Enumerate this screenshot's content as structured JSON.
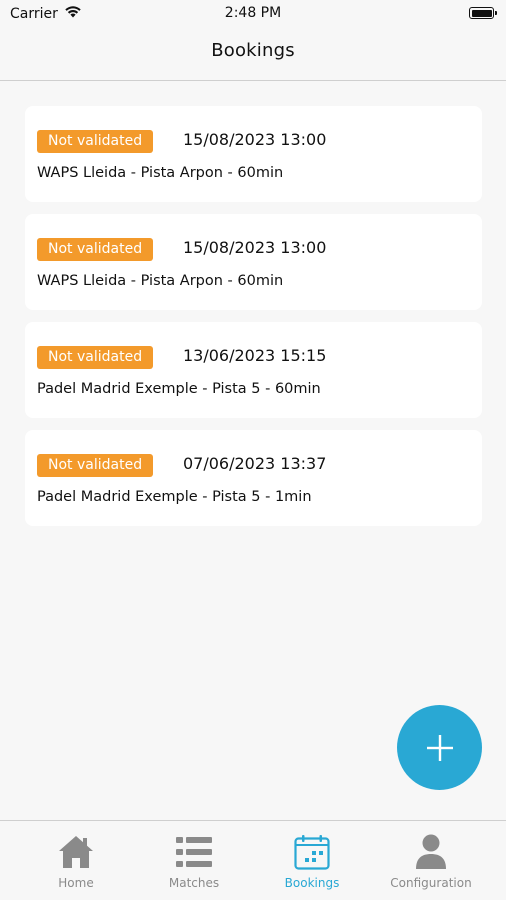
{
  "status_bar": {
    "carrier": "Carrier",
    "time": "2:48 PM"
  },
  "nav": {
    "title": "Bookings"
  },
  "bookings": [
    {
      "status": "Not validated",
      "datetime": "15/08/2023 13:00",
      "name": "WAPS Lleida - Pista Arpon - 60min"
    },
    {
      "status": "Not validated",
      "datetime": "15/08/2023 13:00",
      "name": "WAPS Lleida - Pista Arpon - 60min"
    },
    {
      "status": "Not validated",
      "datetime": "13/06/2023 15:15",
      "name": "Padel Madrid Exemple - Pista 5 - 60min"
    },
    {
      "status": "Not validated",
      "datetime": "07/06/2023 13:37",
      "name": "Padel Madrid Exemple - Pista 5 - 1min"
    }
  ],
  "fab": {
    "icon": "plus-icon"
  },
  "tabs": [
    {
      "label": "Home",
      "icon": "home-icon",
      "active": false
    },
    {
      "label": "Matches",
      "icon": "list-icon",
      "active": false
    },
    {
      "label": "Bookings",
      "icon": "calendar-icon",
      "active": true
    },
    {
      "label": "Configuration",
      "icon": "user-icon",
      "active": false
    }
  ],
  "colors": {
    "badge": "#f39a2b",
    "accent": "#29a8d4",
    "inactive_tab": "#8a8a8a",
    "background": "#f7f7f7"
  }
}
